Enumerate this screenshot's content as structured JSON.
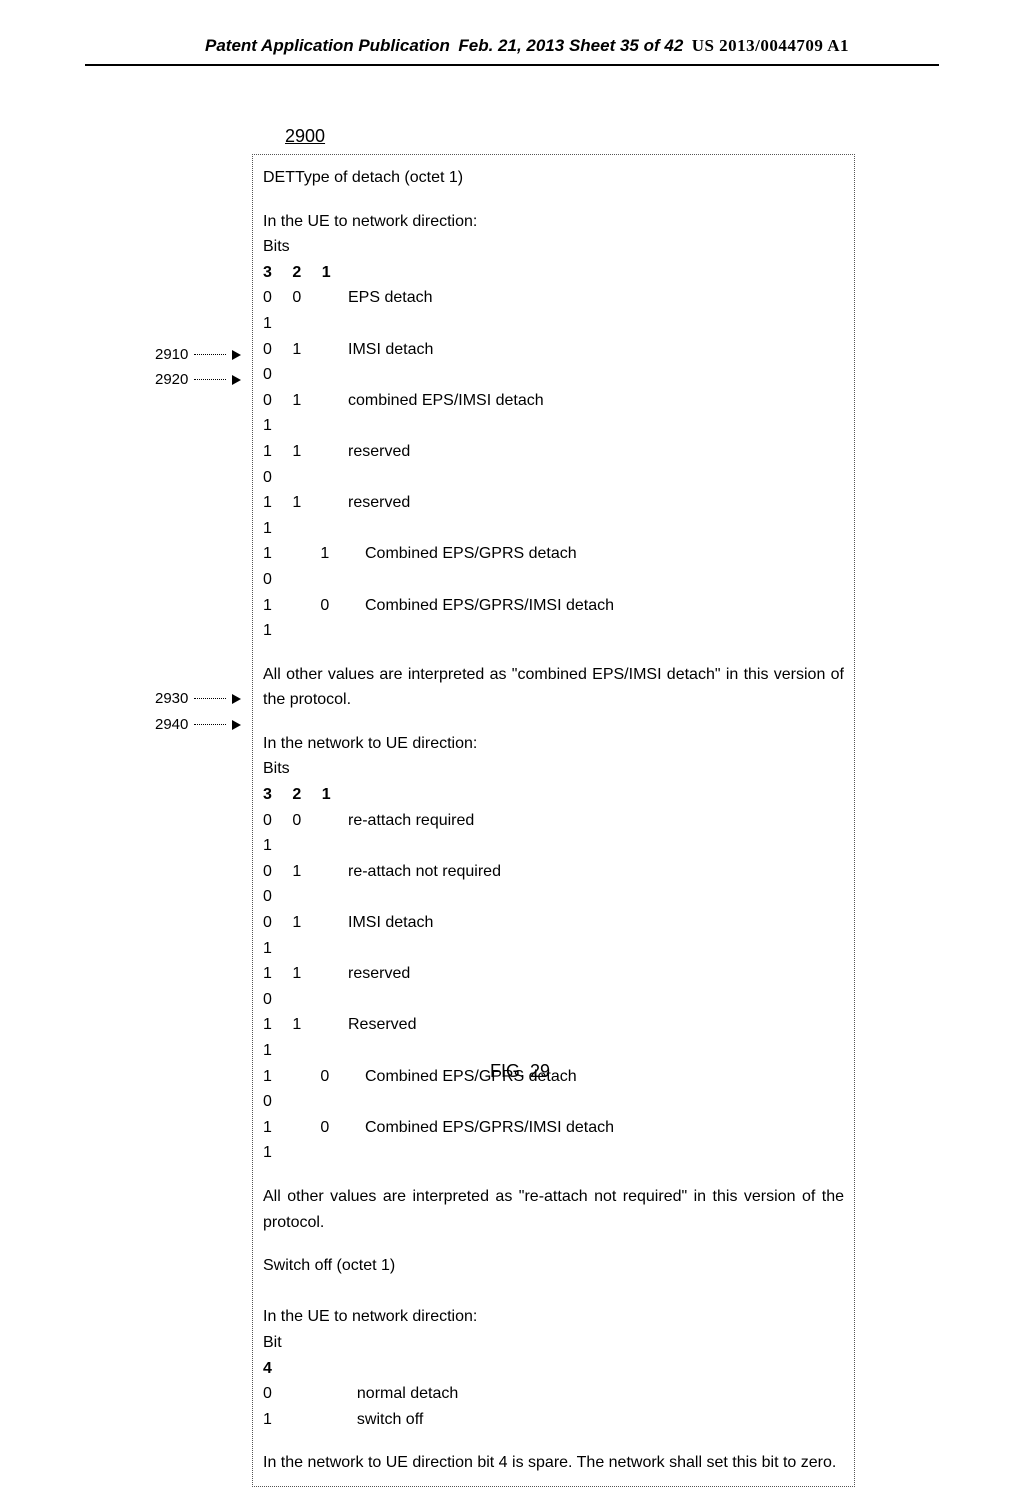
{
  "header": {
    "left": "Patent Application Publication",
    "center": "Feb. 21, 2013  Sheet 35 of 42",
    "right": "US 2013/0044709 A1"
  },
  "figure_number": "2900",
  "box": {
    "title": "DETType of detach (octet 1)",
    "ue_to_net_subtitle": "In the UE to network direction:",
    "bits_label": "Bits",
    "bits_header": "3 2 1",
    "ue_rows": [
      {
        "bits": "0 0 1",
        "label": "EPS detach"
      },
      {
        "bits": "0 1 0",
        "label": "IMSI detach"
      },
      {
        "bits": "0 1 1",
        "label": "combined EPS/IMSI detach"
      },
      {
        "bits": "1 1 0",
        "label": "reserved"
      },
      {
        "bits": "1 1 1",
        "label": "reserved"
      }
    ],
    "ue_new": [
      {
        "bits": "1  1  0",
        "label": "Combined EPS/GPRS detach"
      },
      {
        "bits": "1  0  1",
        "label": "Combined EPS/GPRS/IMSI detach"
      }
    ],
    "ue_note": "All other values are interpreted as \"combined EPS/IMSI detach\" in this version of the protocol.",
    "net_to_ue_subtitle": "In the network to UE direction:",
    "net_rows": [
      {
        "bits": "0 0 1",
        "label": "re-attach required"
      },
      {
        "bits": "0 1 0",
        "label": "re-attach not required"
      },
      {
        "bits": "0 1 1",
        "label": "IMSI detach"
      },
      {
        "bits": "1 1 0",
        "label": "reserved"
      },
      {
        "bits": "1 1 1",
        "label": "Reserved"
      }
    ],
    "net_new": [
      {
        "bits": "1  0  0",
        "label": "Combined EPS/GPRS detach"
      },
      {
        "bits": "1  0  1",
        "label": "Combined EPS/GPRS/IMSI detach"
      }
    ],
    "net_note": "All other values are interpreted as \"re-attach not required\" in this version of the protocol.",
    "switch_title": "Switch off (octet 1)",
    "switch_sub": "In the UE to network direction:",
    "bit_label": "Bit",
    "bit4": "4",
    "switch_rows": [
      {
        "bit": "0",
        "label": "normal detach"
      },
      {
        "bit": "1",
        "label": "switch off"
      }
    ],
    "final_note": "In the network to UE direction bit 4 is spare. The network shall set this bit to zero."
  },
  "callouts": {
    "c2910": "2910",
    "c2920": "2920",
    "c2930": "2930",
    "c2940": "2940"
  },
  "figcaption": "FIG. 29"
}
